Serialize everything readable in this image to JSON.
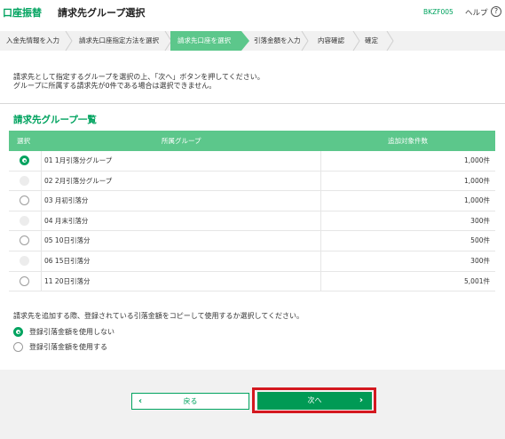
{
  "header": {
    "brand": "口座振替",
    "title": "請求先グループ選択",
    "screen_id": "BKZF005",
    "help_label": "ヘルプ",
    "help_icon": "question-circle-icon"
  },
  "steps": [
    {
      "label": "入金先情報を入力",
      "active": false
    },
    {
      "label": "請求先口座指定方法を選択",
      "active": false
    },
    {
      "label": "請求先口座を選択",
      "active": true
    },
    {
      "label": "引落金額を入力",
      "active": false
    },
    {
      "label": "内容確認",
      "active": false
    },
    {
      "label": "確定",
      "active": false
    }
  ],
  "instructions": {
    "line1": "請求先として指定するグループを選択の上、「次へ」ボタンを押してください。",
    "line2": "グループに所属する請求先が0件である場合は選択できません。"
  },
  "group_list": {
    "title": "請求先グループ一覧",
    "columns": {
      "select": "選択",
      "group": "所属グループ",
      "count": "追加対象件数"
    },
    "rows": [
      {
        "name": "01 1月引落分グループ",
        "count": "1,000件",
        "state": "checked"
      },
      {
        "name": "02 2月引落分グループ",
        "count": "1,000件",
        "state": "disabled"
      },
      {
        "name": "03 月初引落分",
        "count": "1,000件",
        "state": "unchecked"
      },
      {
        "name": "04 月末引落分",
        "count": "300件",
        "state": "disabled"
      },
      {
        "name": "05 10日引落分",
        "count": "500件",
        "state": "unchecked"
      },
      {
        "name": "06 15日引落分",
        "count": "300件",
        "state": "disabled"
      },
      {
        "name": "11 20日引落分",
        "count": "5,001件",
        "state": "unchecked"
      }
    ]
  },
  "copy_option": {
    "question": "請求先を追加する際、登録されている引落金額をコピーして使用するか選択してください。",
    "options": [
      {
        "label": "登録引落金額を使用しない",
        "checked": true
      },
      {
        "label": "登録引落金額を使用する",
        "checked": false
      }
    ]
  },
  "buttons": {
    "back": "戻る",
    "next": "次へ"
  },
  "colors": {
    "accent": "#00a35f",
    "table_header": "#5cc78b",
    "highlight": "#d4181f"
  }
}
